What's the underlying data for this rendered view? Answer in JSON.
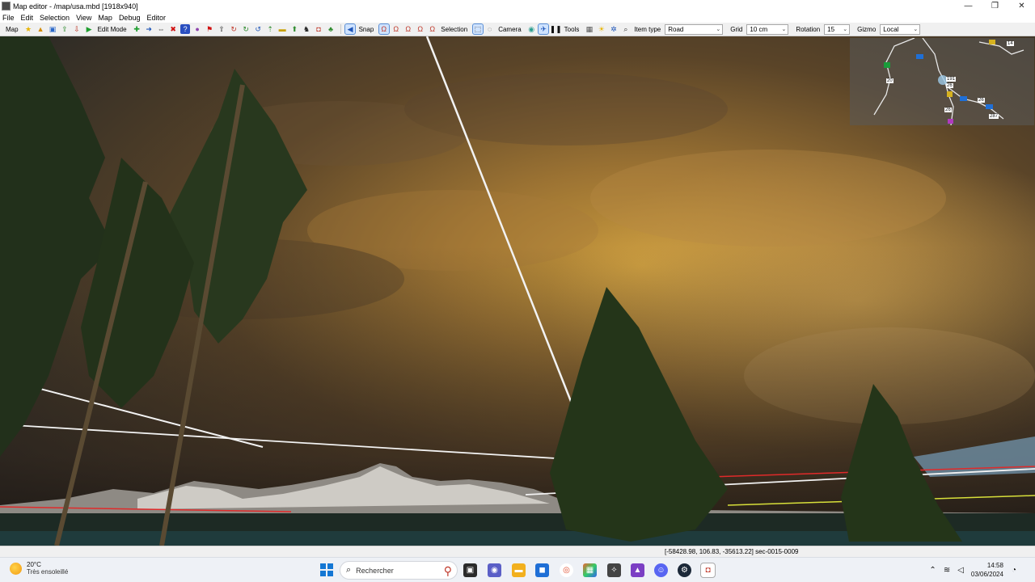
{
  "window": {
    "title": "Map editor - /map/usa.mbd [1918x940]",
    "controls": [
      "—",
      "❐",
      "✕"
    ]
  },
  "menu": [
    "File",
    "Edit",
    "Selection",
    "View",
    "Map",
    "Debug",
    "Editor"
  ],
  "toolbar": {
    "map_label": "Map",
    "edit_mode_label": "Edit Mode",
    "snap_label": "Snap",
    "selection_label": "Selection",
    "camera_label": "Camera",
    "tools_label": "Tools",
    "item_type_label": "Item type",
    "item_type_value": "Road",
    "grid_label": "Grid",
    "grid_value": "10 cm",
    "rotation_label": "Rotation",
    "rotation_value": "15",
    "gizmo_label": "Gizmo",
    "gizmo_value": "Local"
  },
  "minimap": {
    "road_numbers": [
      "20",
      "26",
      "26",
      "287",
      "26",
      "191",
      "14"
    ]
  },
  "status": {
    "coords": "[-58428.98, 106.83, -35613.22] sec-0015-0009"
  },
  "taskbar": {
    "weather_temp": "20°C",
    "weather_cond": "Très ensoleillé",
    "search_placeholder": "Rechercher",
    "time": "14:58",
    "date": "03/06/2024"
  }
}
